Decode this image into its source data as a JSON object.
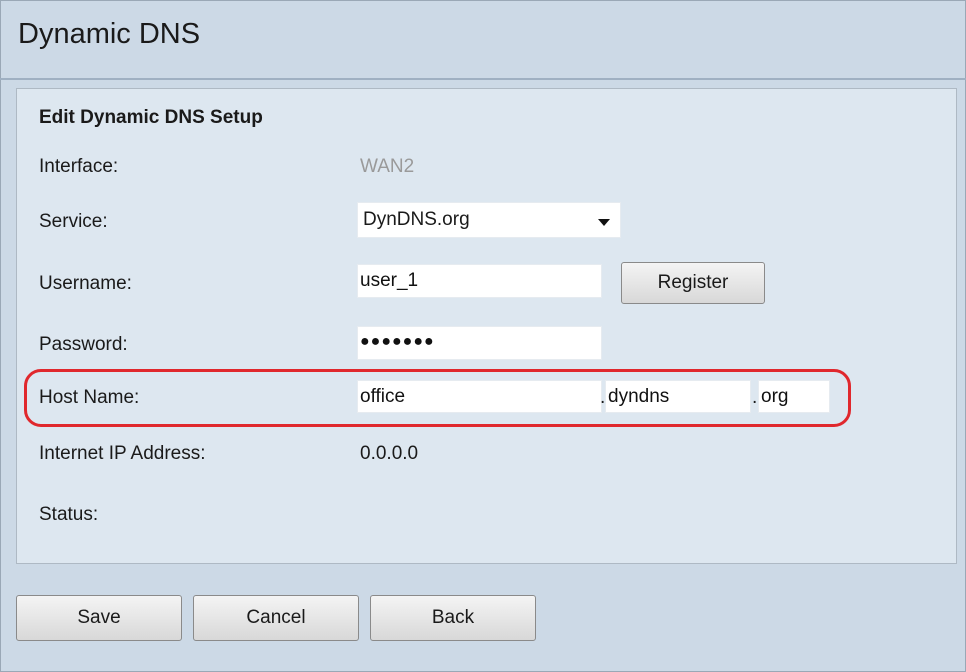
{
  "page": {
    "title": "Dynamic DNS"
  },
  "section": {
    "heading": "Edit Dynamic DNS Setup"
  },
  "form": {
    "interface": {
      "label": "Interface:",
      "value": "WAN2"
    },
    "service": {
      "label": "Service:",
      "selected": "DynDNS.org"
    },
    "username": {
      "label": "Username:",
      "value": "user_1",
      "register_label": "Register"
    },
    "password": {
      "label": "Password:",
      "value": "●●●●●●●"
    },
    "host_name": {
      "label": "Host Name:",
      "host": "office",
      "domain_sep": ".",
      "domain": "dyndns",
      "tld_sep": ".",
      "tld": "org"
    },
    "internet_ip": {
      "label": "Internet IP Address:",
      "value": "0.0.0.0"
    },
    "status": {
      "label": "Status:",
      "value": ""
    }
  },
  "actions": {
    "save_label": "Save",
    "cancel_label": "Cancel",
    "back_label": "Back"
  },
  "colors": {
    "highlight": "#e0282d",
    "background": "#ccd9e6",
    "panel": "#dde7f0"
  }
}
